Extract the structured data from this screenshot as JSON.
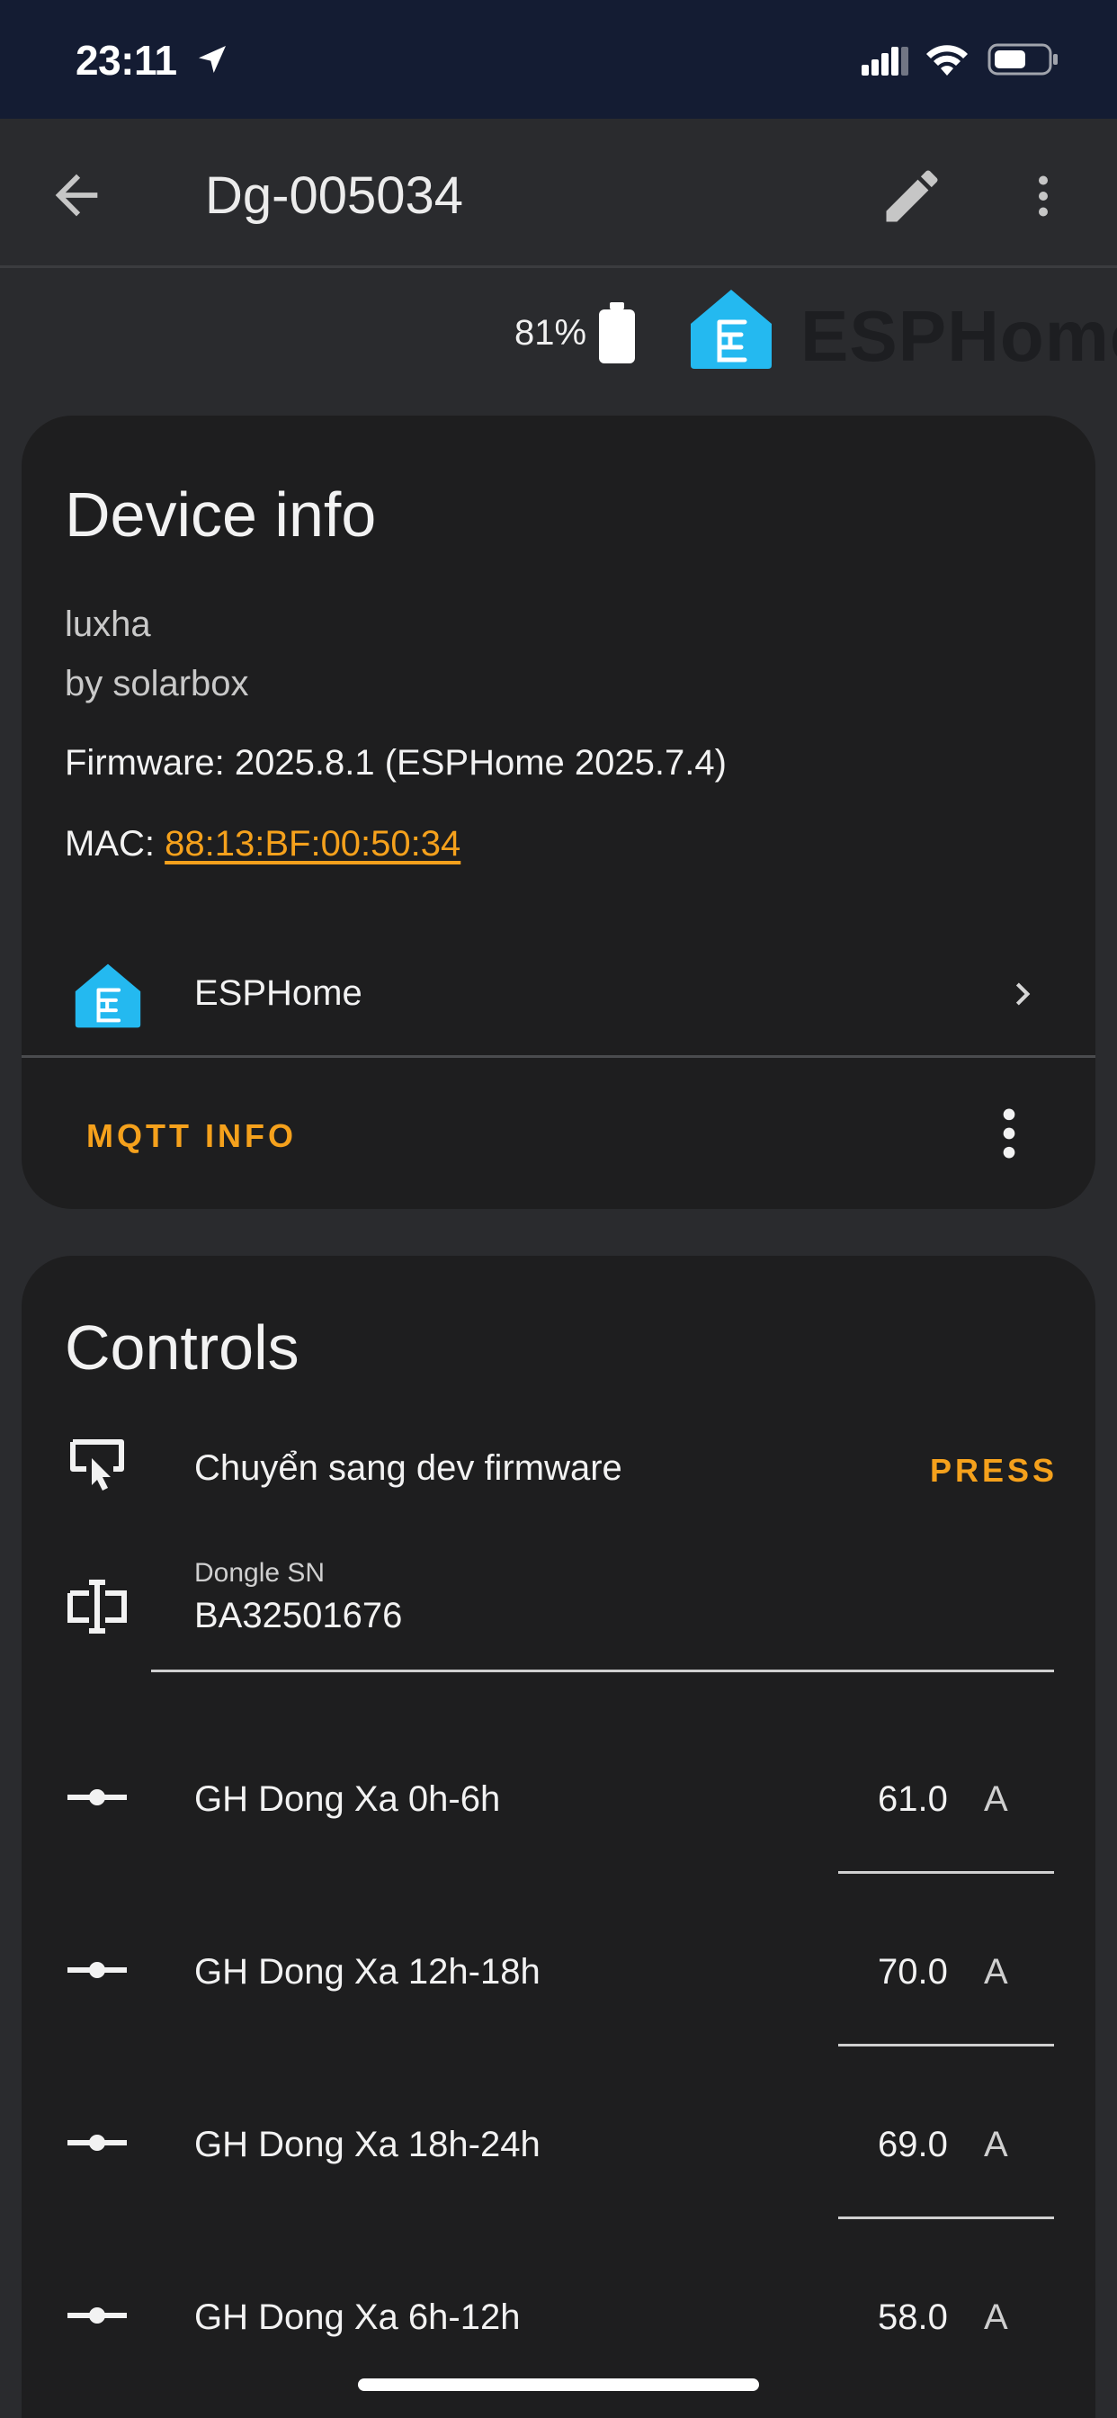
{
  "status_bar": {
    "time": "23:11"
  },
  "app_bar": {
    "title": "Dg-005034"
  },
  "header": {
    "battery_percent": "81%",
    "brand_name": "ESPHome",
    "brand_color": "#24b9f0"
  },
  "device_info": {
    "title": "Device info",
    "model": "luxha",
    "manufacturer": "by solarbox",
    "firmware_label": "Firmware: 2025.8.1 (ESPHome 2025.7.4)",
    "mac_label": "MAC: ",
    "mac_value": "88:13:BF:00:50:34",
    "integration_label": "ESPHome",
    "mqtt_button": "MQTT INFO"
  },
  "controls": {
    "title": "Controls",
    "firmware_switch": {
      "label": "Chuyển sang dev firmware",
      "action": "PRESS"
    },
    "dongle_sn": {
      "label": "Dongle SN",
      "value": "BA32501676"
    },
    "number_entities": [
      {
        "label": "GH Dong Xa 0h-6h",
        "value": "61.0",
        "unit": "A"
      },
      {
        "label": "GH Dong Xa 12h-18h",
        "value": "70.0",
        "unit": "A"
      },
      {
        "label": "GH Dong Xa 18h-24h",
        "value": "69.0",
        "unit": "A"
      },
      {
        "label": "GH Dong Xa 6h-12h",
        "value": "58.0",
        "unit": "A"
      }
    ]
  },
  "colors": {
    "accent": "#f5a11c",
    "status_bar_bg": "#141c33",
    "card_bg": "#1e1e1f"
  }
}
